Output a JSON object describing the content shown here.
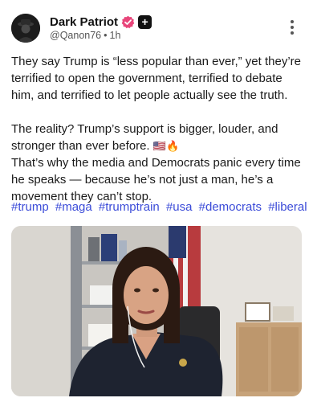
{
  "author": {
    "display_name": "Dark Patriot",
    "handle": "@Qanon76",
    "separator": "•",
    "timestamp": "1h",
    "verified_badge_icon": "verified-badge-icon",
    "plus_badge_icon": "plus-badge-icon",
    "plus_symbol": "+"
  },
  "post": {
    "paragraph1": "They say Trump is “less popular than ever,” yet they’re terrified to open the government, terrified to debate him, and terrified to let people actually see the truth.",
    "paragraph2_line1": "The reality? Trump’s support is bigger, louder, and stronger than ever before.",
    "paragraph2_emoji": "🇺🇸🔥",
    "paragraph2_line2": "That’s why the media and Democrats panic every time he speaks — because he’s not just a man, he’s a movement they can’t stop.",
    "hashtags": [
      "#trump",
      "#maga",
      "#trumptrain",
      "#usa",
      "#democrats",
      "#liberal"
    ]
  },
  "colors": {
    "hashtag": "#3b4bd8",
    "verified_badge": "#e8457a"
  },
  "icons": {
    "more": "more-options-icon"
  }
}
